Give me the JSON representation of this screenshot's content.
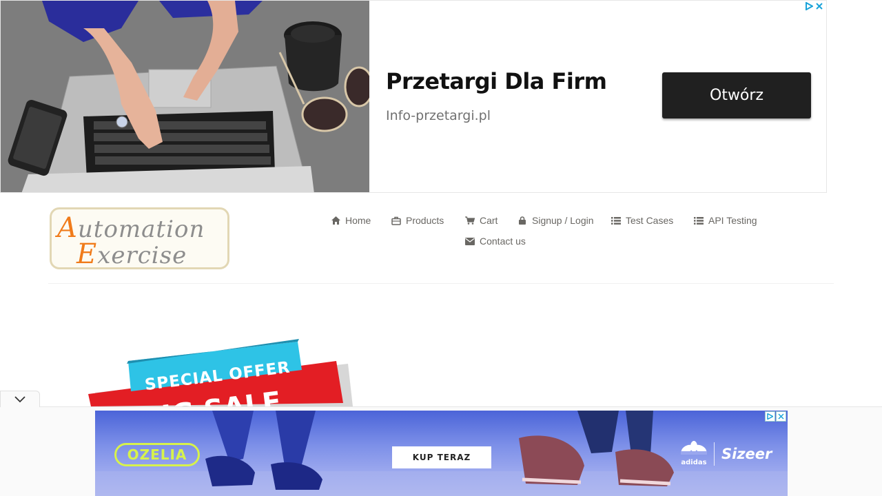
{
  "top_ad": {
    "title": "Przetargi Dla Firm",
    "url": "Info-przetargi.pl",
    "button_label": "Otwórz"
  },
  "logo": {
    "line1_cap": "A",
    "line1_rest": "utomation",
    "line2_cap": "E",
    "line2_rest": "xercise"
  },
  "nav": {
    "items": [
      {
        "label": "Home",
        "icon": "home-icon"
      },
      {
        "label": "Products",
        "icon": "briefcase-icon"
      },
      {
        "label": "Cart",
        "icon": "cart-icon"
      },
      {
        "label": "Signup / Login",
        "icon": "lock-icon"
      },
      {
        "label": "Test Cases",
        "icon": "list-icon"
      },
      {
        "label": "API Testing",
        "icon": "list-icon"
      },
      {
        "label": "Contact us",
        "icon": "envelope-icon"
      }
    ]
  },
  "banner": {
    "line1": "SPECIAL OFFER",
    "line2": "BIG SALE"
  },
  "bottom_ad": {
    "brand": "OZELIA",
    "button_label": "KUP TERAZ",
    "partner1": "adidas",
    "partner2": "Sizeer"
  },
  "colors": {
    "nav_text": "#696763",
    "logo_accent": "#f07b1a",
    "ad_button": "#202020",
    "ozelia_lime": "#d7f24b",
    "banner_red": "#e31e24",
    "banner_cyan": "#2ec3e6"
  }
}
